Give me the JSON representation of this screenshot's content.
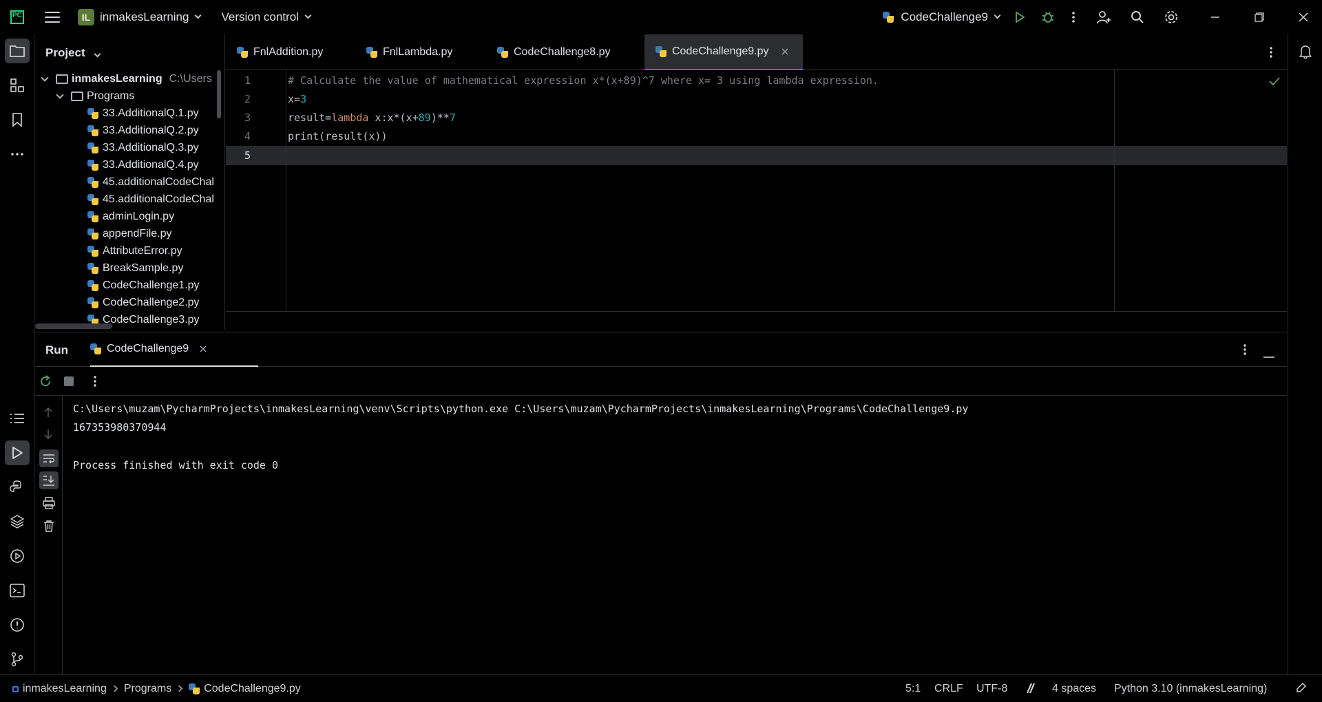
{
  "titlebar": {
    "project_badge": "IL",
    "project_name": "inmakesLearning",
    "vcs": "Version control",
    "run_config": "CodeChallenge9"
  },
  "project_panel": {
    "title": "Project",
    "root_name": "inmakesLearning",
    "root_path": "C:\\Users",
    "folder": "Programs",
    "files": [
      "33.AdditionalQ.1.py",
      "33.AdditionalQ.2.py",
      "33.AdditionalQ.3.py",
      "33.AdditionalQ.4.py",
      "45.additionalCodeChal",
      "45.additionalCodeChal",
      "adminLogin.py",
      "appendFile.py",
      "AttributeError.py",
      "BreakSample.py",
      "CodeChallenge1.py",
      "CodeChallenge2.py",
      "CodeChallenge3.py"
    ]
  },
  "tabs": [
    {
      "label": "FnlAddition.py"
    },
    {
      "label": "FnlLambda.py"
    },
    {
      "label": "CodeChallenge8.py"
    },
    {
      "label": "CodeChallenge9.py",
      "active": true
    }
  ],
  "editor": {
    "line_numbers": [
      "1",
      "2",
      "3",
      "4",
      "5"
    ],
    "line1_comment": "# Calculate the value of mathematical expression x*(x+89)^7 where x= 3 using lambda expression.",
    "line2_a": "x=",
    "line2_num": "3",
    "line3_a": "result=",
    "line3_kw": "lambda",
    "line3_b": " x:x*(x+",
    "line3_num1": "89",
    "line3_c": ")**",
    "line3_num2": "7",
    "line4": "print(result(x))"
  },
  "run": {
    "title": "Run",
    "tab_label": "CodeChallenge9",
    "output": [
      "C:\\Users\\muzam\\PycharmProjects\\inmakesLearning\\venv\\Scripts\\python.exe C:\\Users\\muzam\\PycharmProjects\\inmakesLearning\\Programs\\CodeChallenge9.py",
      "167353980370944",
      "",
      "Process finished with exit code 0"
    ]
  },
  "statusbar": {
    "crumb_project": "inmakesLearning",
    "crumb_folder": "Programs",
    "crumb_file": "CodeChallenge9.py",
    "position": "5:1",
    "line_sep": "CRLF",
    "encoding": "UTF-8",
    "indent": "4 spaces",
    "interpreter": "Python 3.10 (inmakesLearning)"
  }
}
